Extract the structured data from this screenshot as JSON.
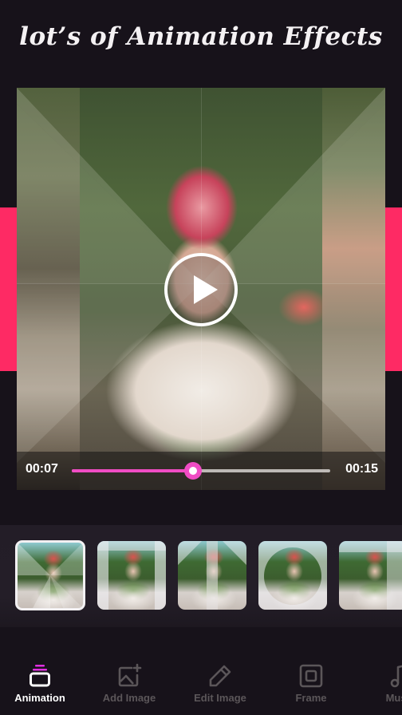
{
  "headline": "lot’s of Animation Effects",
  "colors": {
    "accent_pink": "#fe2a64",
    "progress_magenta": "#f04cc4",
    "background": "#17121a",
    "nav_inactive": "#5b5659",
    "nav_active": "#ffffff"
  },
  "player": {
    "current_time": "00:07",
    "total_time": "00:15",
    "progress": 0.47,
    "play_icon": "play-icon"
  },
  "thumbnails": [
    {
      "label": "effect-1",
      "selected": true
    },
    {
      "label": "effect-2",
      "selected": false
    },
    {
      "label": "effect-3",
      "selected": false
    },
    {
      "label": "effect-4",
      "selected": false
    },
    {
      "label": "effect-5",
      "selected": false
    }
  ],
  "nav": {
    "items": [
      {
        "label": "Animation",
        "icon": "layers-icon",
        "active": true
      },
      {
        "label": "Add Image",
        "icon": "add-image-icon",
        "active": false
      },
      {
        "label": "Edit Image",
        "icon": "pencil-icon",
        "active": false
      },
      {
        "label": "Frame",
        "icon": "frame-icon",
        "active": false
      },
      {
        "label": "Music",
        "icon": "music-note-icon",
        "active": false
      }
    ]
  }
}
